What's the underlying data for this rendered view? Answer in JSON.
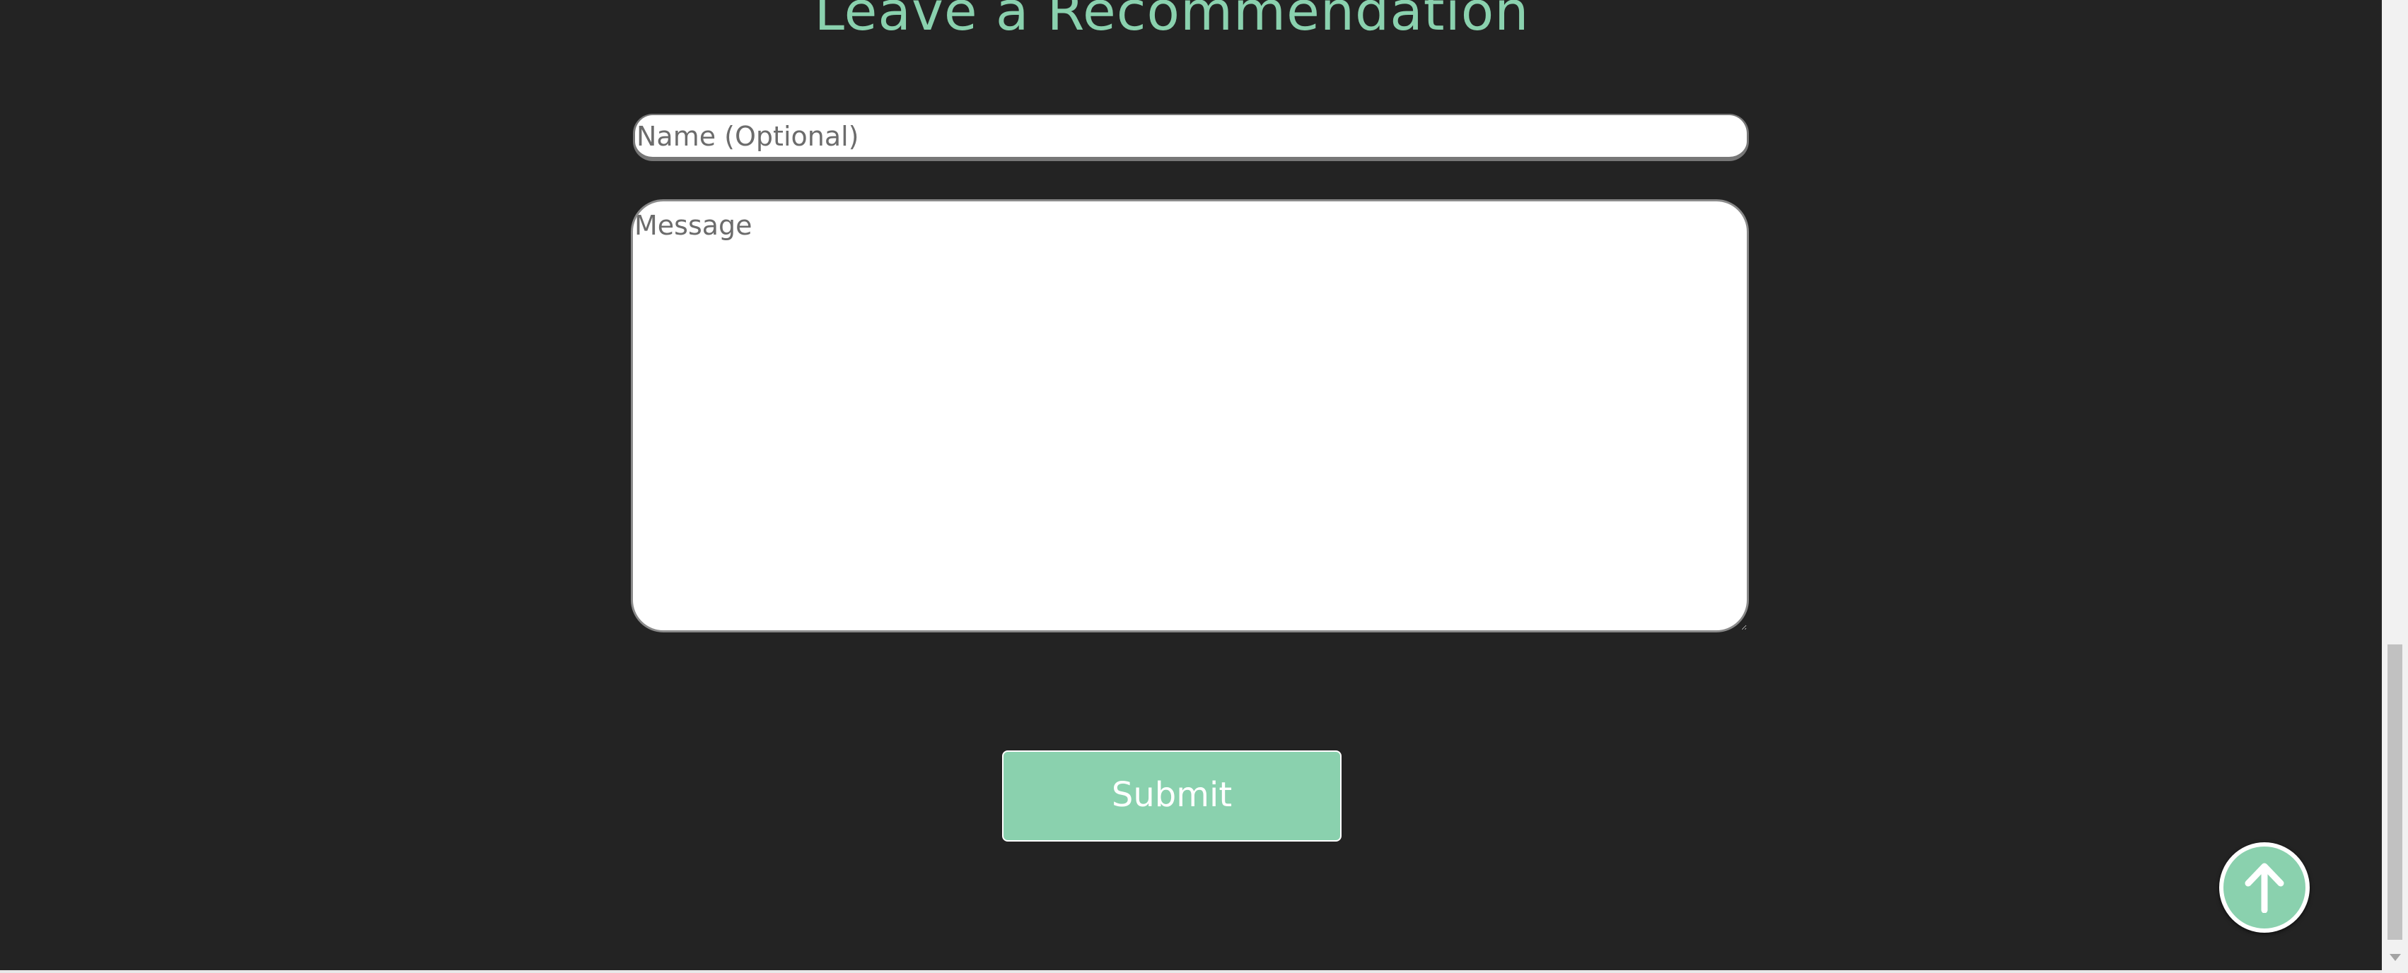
{
  "form": {
    "heading": "Leave a Recommendation",
    "name_placeholder": "Name (Optional)",
    "message_placeholder": "Message",
    "submit_label": "Submit"
  },
  "scroll_top_button": {
    "icon": "arrow-up-icon"
  },
  "colors": {
    "background": "#232323",
    "accent": "#8ad1ae",
    "input_background": "#ffffff",
    "placeholder_text": "#6c6c6c"
  }
}
